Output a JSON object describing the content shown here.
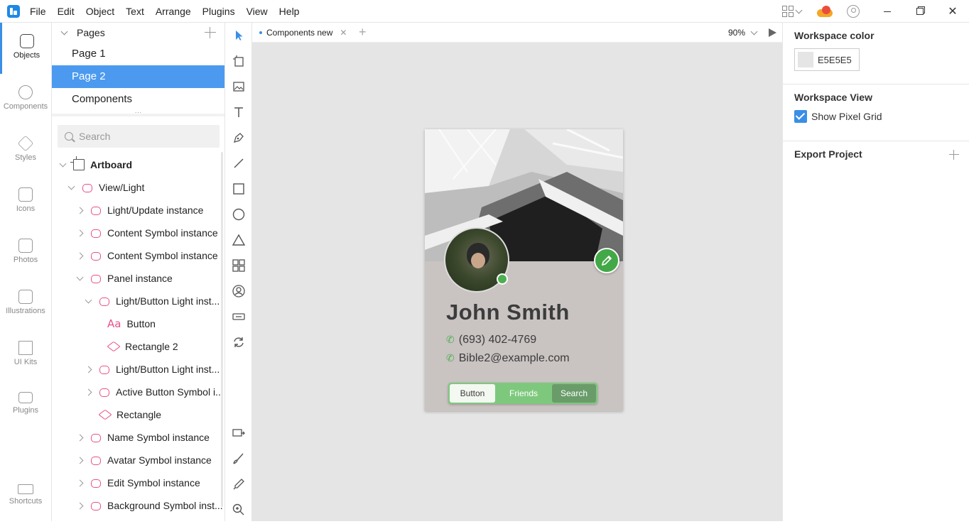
{
  "menu": [
    "File",
    "Edit",
    "Object",
    "Text",
    "Arrange",
    "Plugins",
    "View",
    "Help"
  ],
  "rail": {
    "objects": "Objects",
    "components": "Components",
    "styles": "Styles",
    "icons": "Icons",
    "photos": "Photos",
    "illustrations": "Illustrations",
    "ui_kits": "UI Kits",
    "plugins": "Plugins",
    "shortcuts": "Shortcuts"
  },
  "pages": {
    "title": "Pages",
    "items": [
      "Page 1",
      "Page 2",
      "Components"
    ],
    "selected": "Page 2"
  },
  "search": {
    "placeholder": "Search"
  },
  "tree": [
    {
      "label": "Artboard",
      "icon": "artboard-icon",
      "depth": 0,
      "toggle": "open"
    },
    {
      "label": "View/Light",
      "icon": "symbol-icon",
      "depth": 1,
      "toggle": "open"
    },
    {
      "label": "Light/Update instance",
      "icon": "symbol-icon",
      "depth": 2,
      "toggle": "closed"
    },
    {
      "label": "Content Symbol instance",
      "icon": "symbol-icon",
      "depth": 2,
      "toggle": "closed"
    },
    {
      "label": "Content Symbol instance",
      "icon": "symbol-icon",
      "depth": 2,
      "toggle": "closed"
    },
    {
      "label": "Panel instance",
      "icon": "symbol-icon",
      "depth": 2,
      "toggle": "open"
    },
    {
      "label": "Light/Button Light inst...",
      "icon": "symbol-icon",
      "depth": 3,
      "toggle": "open"
    },
    {
      "label": "Button",
      "icon": "text-icon",
      "depth": 4,
      "toggle": "none"
    },
    {
      "label": "Rectangle 2",
      "icon": "rectangle-icon",
      "depth": 4,
      "toggle": "none"
    },
    {
      "label": "Light/Button Light inst...",
      "icon": "symbol-icon",
      "depth": 3,
      "toggle": "closed"
    },
    {
      "label": "Active Button Symbol i...",
      "icon": "symbol-icon",
      "depth": 3,
      "toggle": "closed"
    },
    {
      "label": "Rectangle",
      "icon": "rectangle-icon",
      "depth": 3,
      "toggle": "none"
    },
    {
      "label": "Name Symbol instance",
      "icon": "symbol-icon",
      "depth": 2,
      "toggle": "closed"
    },
    {
      "label": "Avatar Symbol instance",
      "icon": "symbol-icon",
      "depth": 2,
      "toggle": "closed"
    },
    {
      "label": "Edit Symbol instance",
      "icon": "symbol-icon",
      "depth": 2,
      "toggle": "closed"
    },
    {
      "label": "Background Symbol inst...",
      "icon": "symbol-icon",
      "depth": 2,
      "toggle": "closed"
    }
  ],
  "tabs": {
    "active": "Components new",
    "close": "✕",
    "add": "+"
  },
  "zoom": "90%",
  "card": {
    "name": "John Smith",
    "phone": "(693) 402-4769",
    "email": "Bible2@example.com",
    "segments": [
      "Button",
      "Friends",
      "Search"
    ]
  },
  "right": {
    "workspace_color_title": "Workspace color",
    "workspace_color_value": "E5E5E5",
    "workspace_view_title": "Workspace View",
    "show_pixel_grid": "Show Pixel Grid",
    "export_title": "Export Project"
  },
  "colors": {
    "accent": "#3a8ee6",
    "selection": "#4b9af0",
    "symbol": "#e8508a",
    "workspace": "#e5e5e5",
    "card_bg": "#c9c3c2",
    "segment_green": "#7ec87e"
  }
}
